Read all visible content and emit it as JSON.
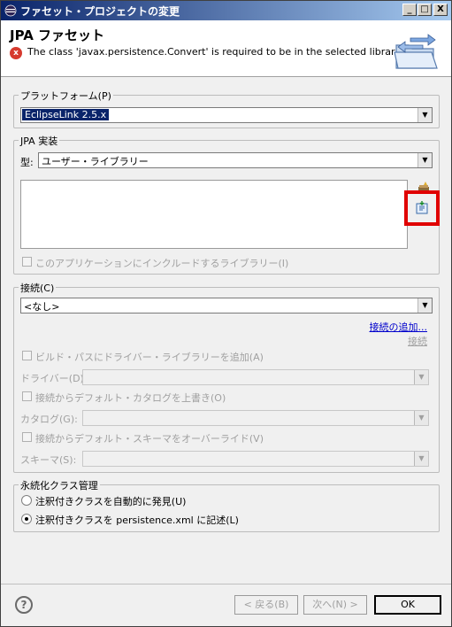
{
  "window": {
    "title": "ファセット・プロジェクトの変更",
    "icon": "eclipse-icon",
    "min_label": "_",
    "max_label": "□",
    "close_label": "X"
  },
  "header": {
    "title": "JPA ファセット",
    "message": "The class 'javax.persistence.Convert' is required to be in the selected libraries.",
    "error_icon": "x",
    "banner_icon": "folder-arrows-icon"
  },
  "platform": {
    "group_label": "プラットフォーム(P)",
    "selected": "EclipseLink 2.5.x"
  },
  "jpa_impl": {
    "group_label": "JPA 実装",
    "type_label": "型:",
    "type_selected": "ユーザー・ライブラリー",
    "include_checkbox_label": "このアプリケーションにインクルードするライブラリー(I)",
    "side_icons": [
      "manage-libraries-icon",
      "download-library-icon"
    ],
    "highlight_color": "#e00000"
  },
  "connection": {
    "label": "接続(C)",
    "selected": "<なし>",
    "add_link": "接続の追加...",
    "connect_link": "接続",
    "add_driver_checkbox": "ビルド・パスにドライバー・ライブラリーを追加(A)",
    "driver_label": "ドライバー(D):",
    "override_catalog_checkbox": "接続からデフォルト・カタログを上書き(O)",
    "catalog_label": "カタログ(G):",
    "override_schema_checkbox": "接続からデフォルト・スキーマをオーバーライド(V)",
    "schema_label": "スキーマ(S):"
  },
  "persistence": {
    "group_label": "永続化クラス管理",
    "option_auto": "注釈付きクラスを自動的に発見(U)",
    "option_list": "注釈付きクラスを persistence.xml に記述(L)",
    "selected_option": "option_list"
  },
  "footer": {
    "help_label": "?",
    "back_label": "< 戻る(B)",
    "next_label": "次へ(N) >",
    "ok_label": "OK"
  }
}
